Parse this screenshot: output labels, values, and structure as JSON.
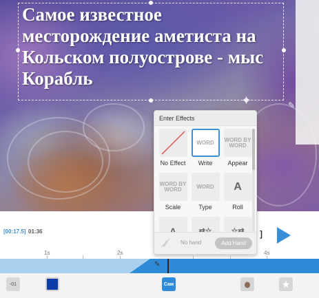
{
  "slide": {
    "title": "Самое известное месторождение аметиста на Кольском полуострове - мыс Корабль"
  },
  "effects_popup": {
    "header": "Enter Effects",
    "effects": [
      {
        "label": "No Effect",
        "thumb": "",
        "selected": false
      },
      {
        "label": "Write",
        "thumb": "WORD",
        "selected": true
      },
      {
        "label": "Appear",
        "thumb": "WORD BY WORD",
        "selected": false
      },
      {
        "label": "Scale",
        "thumb": "WORD BY WORD",
        "selected": false
      },
      {
        "label": "Type",
        "thumb": "WORD",
        "selected": false
      },
      {
        "label": "Roll",
        "thumb": "A",
        "selected": false
      },
      {
        "label": "",
        "thumb": "A",
        "selected": false
      },
      {
        "label": "",
        "thumb": "⇄☆",
        "selected": false
      },
      {
        "label": "",
        "thumb": "☆⇄",
        "selected": false
      }
    ],
    "no_hand": "No hand",
    "add_hand": "Add Hand"
  },
  "player": {
    "current_time": "[00:17.5]",
    "total_time": "01:36"
  },
  "timeline": {
    "ticks": [
      "1s",
      "2s",
      "4s"
    ],
    "clips": [
      "-01",
      "",
      "Сам",
      "",
      "★"
    ]
  },
  "colors": {
    "accent": "#2f8bd8",
    "track_light": "#a9d1ee",
    "clip_color": "#0f3da8"
  }
}
